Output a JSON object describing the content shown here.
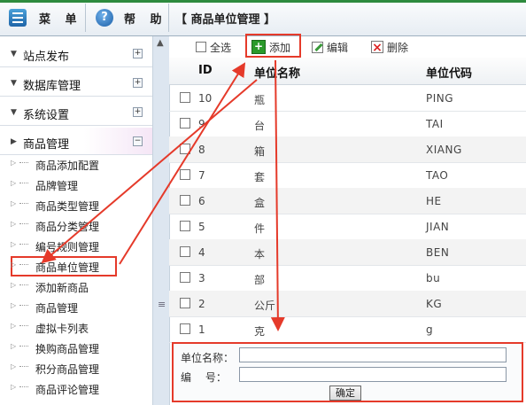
{
  "topbar": {
    "menu_label": "菜 单",
    "help_label": "帮 助",
    "page_title": "【 商品单位管理 】"
  },
  "sidebar": {
    "sections": [
      {
        "label": "站点发布",
        "toggle": "+"
      },
      {
        "label": "数据库管理",
        "toggle": "+"
      },
      {
        "label": "系统设置",
        "toggle": "+"
      },
      {
        "label": "商品管理",
        "toggle": "−"
      }
    ],
    "items": [
      {
        "label": "商品添加配置"
      },
      {
        "label": "品牌管理"
      },
      {
        "label": "商品类型管理"
      },
      {
        "label": "商品分类管理"
      },
      {
        "label": "编号规则管理"
      },
      {
        "label": "商品单位管理"
      },
      {
        "label": "添加新商品"
      },
      {
        "label": "商品管理"
      },
      {
        "label": "虚拟卡列表"
      },
      {
        "label": "换购商品管理"
      },
      {
        "label": "积分商品管理"
      },
      {
        "label": "商品评论管理"
      }
    ]
  },
  "toolbar": {
    "select_all": "全选",
    "add": "添加",
    "edit": "编辑",
    "delete": "删除"
  },
  "table": {
    "columns": [
      "ID",
      "单位名称",
      "单位代码"
    ],
    "rows": [
      {
        "id": "10",
        "name": "瓶",
        "code": "PING"
      },
      {
        "id": "9",
        "name": "台",
        "code": "TAI"
      },
      {
        "id": "8",
        "name": "箱",
        "code": "XIANG"
      },
      {
        "id": "7",
        "name": "套",
        "code": "TAO"
      },
      {
        "id": "6",
        "name": "盒",
        "code": "HE"
      },
      {
        "id": "5",
        "name": "件",
        "code": "JIAN"
      },
      {
        "id": "4",
        "name": "本",
        "code": "BEN"
      },
      {
        "id": "3",
        "name": "部",
        "code": "bu"
      },
      {
        "id": "2",
        "name": "公斤",
        "code": "KG"
      },
      {
        "id": "1",
        "name": "克",
        "code": "g"
      }
    ]
  },
  "form": {
    "name_label": "单位名称：",
    "code_label": "编　 号：",
    "name_value": "",
    "code_value": "",
    "submit": "确定"
  },
  "colors": {
    "annotation_red": "#e53a2a",
    "accent_green": "#2e8b3e"
  }
}
